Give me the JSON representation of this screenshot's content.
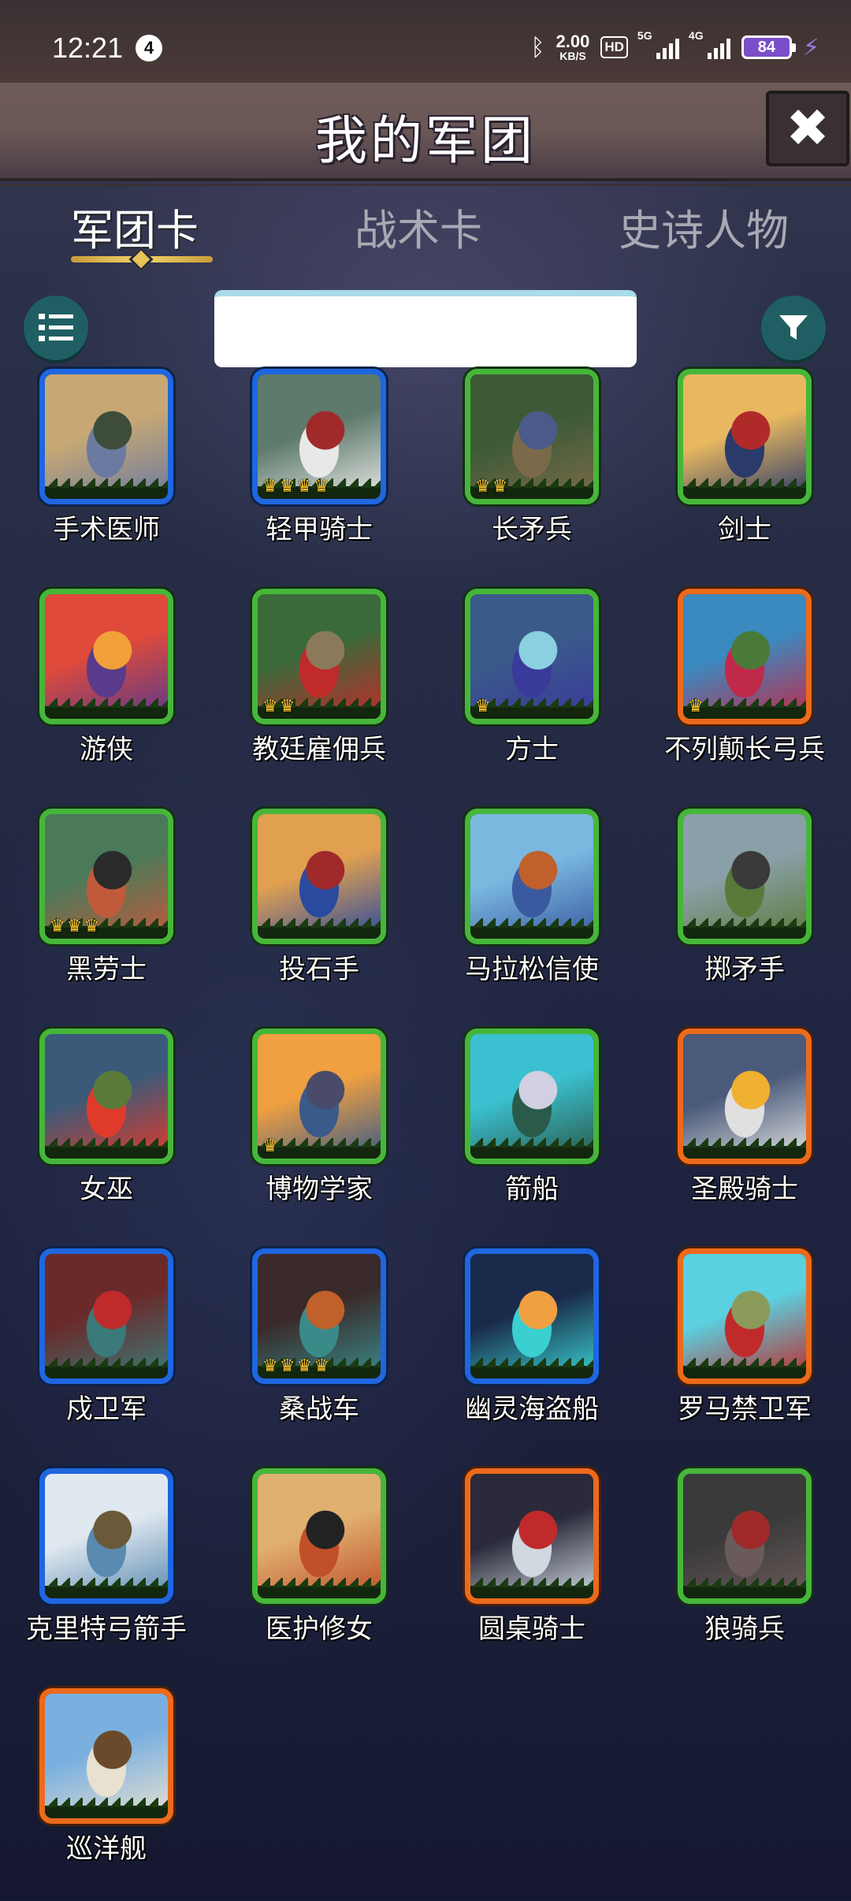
{
  "status_bar": {
    "time": "12:21",
    "notification_count": "4",
    "net_speed_value": "2.00",
    "net_speed_unit": "KB/S",
    "hd_label": "HD",
    "signal_1_label": "5G",
    "signal_2_label": "4G",
    "battery": "84"
  },
  "header": {
    "title": "我的军团",
    "close_label": "✖"
  },
  "tabs": [
    {
      "label": "军团卡",
      "active": true
    },
    {
      "label": "战术卡",
      "active": false
    },
    {
      "label": "史诗人物",
      "active": false
    }
  ],
  "search": {
    "value": "",
    "placeholder": ""
  },
  "cards": [
    {
      "name": "手术医师",
      "rarity": "blue",
      "crowns": 0,
      "art": [
        "#c7a874",
        "#6b7aa0",
        "#3d4d3a"
      ]
    },
    {
      "name": "轻甲骑士",
      "rarity": "blue",
      "crowns": 4,
      "art": [
        "#5d7a6a",
        "#e8e8e8",
        "#a02a2a"
      ]
    },
    {
      "name": "长矛兵",
      "rarity": "green",
      "crowns": 2,
      "art": [
        "#3c5a36",
        "#7a6a4a",
        "#4a5a8a"
      ]
    },
    {
      "name": "剑士",
      "rarity": "green",
      "crowns": 0,
      "art": [
        "#e8b860",
        "#2a3a6a",
        "#b02a2a"
      ]
    },
    {
      "name": "游侠",
      "rarity": "green",
      "crowns": 0,
      "art": [
        "#e04a3a",
        "#5a3a8a",
        "#f2a03a"
      ]
    },
    {
      "name": "教廷雇佣兵",
      "rarity": "green",
      "crowns": 2,
      "art": [
        "#3a6a3a",
        "#c02a2a",
        "#8a7a5a"
      ]
    },
    {
      "name": "方士",
      "rarity": "green",
      "crowns": 1,
      "art": [
        "#3a5a8a",
        "#3a3a9a",
        "#8ad0e0"
      ]
    },
    {
      "name": "不列颠长弓兵",
      "rarity": "orange",
      "crowns": 1,
      "art": [
        "#3a8ac0",
        "#c02a4a",
        "#4a7a3a"
      ]
    },
    {
      "name": "黑劳士",
      "rarity": "green",
      "crowns": 3,
      "art": [
        "#4a7a5a",
        "#c05a3a",
        "#2a2a2a"
      ]
    },
    {
      "name": "投石手",
      "rarity": "green",
      "crowns": 0,
      "art": [
        "#e0a050",
        "#2a4aa0",
        "#a02a2a"
      ]
    },
    {
      "name": "马拉松信使",
      "rarity": "green",
      "crowns": 0,
      "art": [
        "#7ab8e0",
        "#3a5aa0",
        "#c0602a"
      ]
    },
    {
      "name": "掷矛手",
      "rarity": "green",
      "crowns": 0,
      "art": [
        "#8aa0a8",
        "#5a7a3a",
        "#3a3a3a"
      ]
    },
    {
      "name": "女巫",
      "rarity": "green",
      "crowns": 0,
      "art": [
        "#3a5a7a",
        "#e03a2a",
        "#5a7a3a"
      ]
    },
    {
      "name": "博物学家",
      "rarity": "green",
      "crowns": 1,
      "art": [
        "#f0a040",
        "#3a5a8a",
        "#4a4a6a"
      ]
    },
    {
      "name": "箭船",
      "rarity": "green",
      "crowns": 0,
      "art": [
        "#3ac0d0",
        "#2a5a4a",
        "#d0d0e0"
      ]
    },
    {
      "name": "圣殿骑士",
      "rarity": "orange",
      "crowns": 0,
      "art": [
        "#4a5a7a",
        "#e0e0e0",
        "#f0b030"
      ]
    },
    {
      "name": "戍卫军",
      "rarity": "blue",
      "crowns": 0,
      "art": [
        "#6a2a2a",
        "#3a7a7a",
        "#c02a2a"
      ]
    },
    {
      "name": "桑战车",
      "rarity": "blue",
      "crowns": 4,
      "art": [
        "#3a2a2a",
        "#3a8a8a",
        "#c0602a"
      ]
    },
    {
      "name": "幽灵海盗船",
      "rarity": "blue",
      "crowns": 0,
      "art": [
        "#1a2a4a",
        "#3ad0d0",
        "#f0a040"
      ]
    },
    {
      "name": "罗马禁卫军",
      "rarity": "orange",
      "crowns": 0,
      "art": [
        "#5ad0e0",
        "#c02a2a",
        "#8a9a5a"
      ]
    },
    {
      "name": "克里特弓箭手",
      "rarity": "blue",
      "crowns": 0,
      "art": [
        "#e0e8f0",
        "#5a8ab0",
        "#6a5a3a"
      ]
    },
    {
      "name": "医护修女",
      "rarity": "green",
      "crowns": 0,
      "art": [
        "#e0b070",
        "#c0502a",
        "#222222"
      ]
    },
    {
      "name": "圆桌骑士",
      "rarity": "orange",
      "crowns": 0,
      "art": [
        "#2a2a3a",
        "#d0d8e0",
        "#c02a2a"
      ]
    },
    {
      "name": "狼骑兵",
      "rarity": "green",
      "crowns": 0,
      "art": [
        "#3a3a3a",
        "#6a5a5a",
        "#a02a2a"
      ]
    },
    {
      "name": "巡洋舰",
      "rarity": "orange",
      "crowns": 0,
      "art": [
        "#7ab0e0",
        "#e8e0d0",
        "#6a4a2a"
      ]
    }
  ]
}
